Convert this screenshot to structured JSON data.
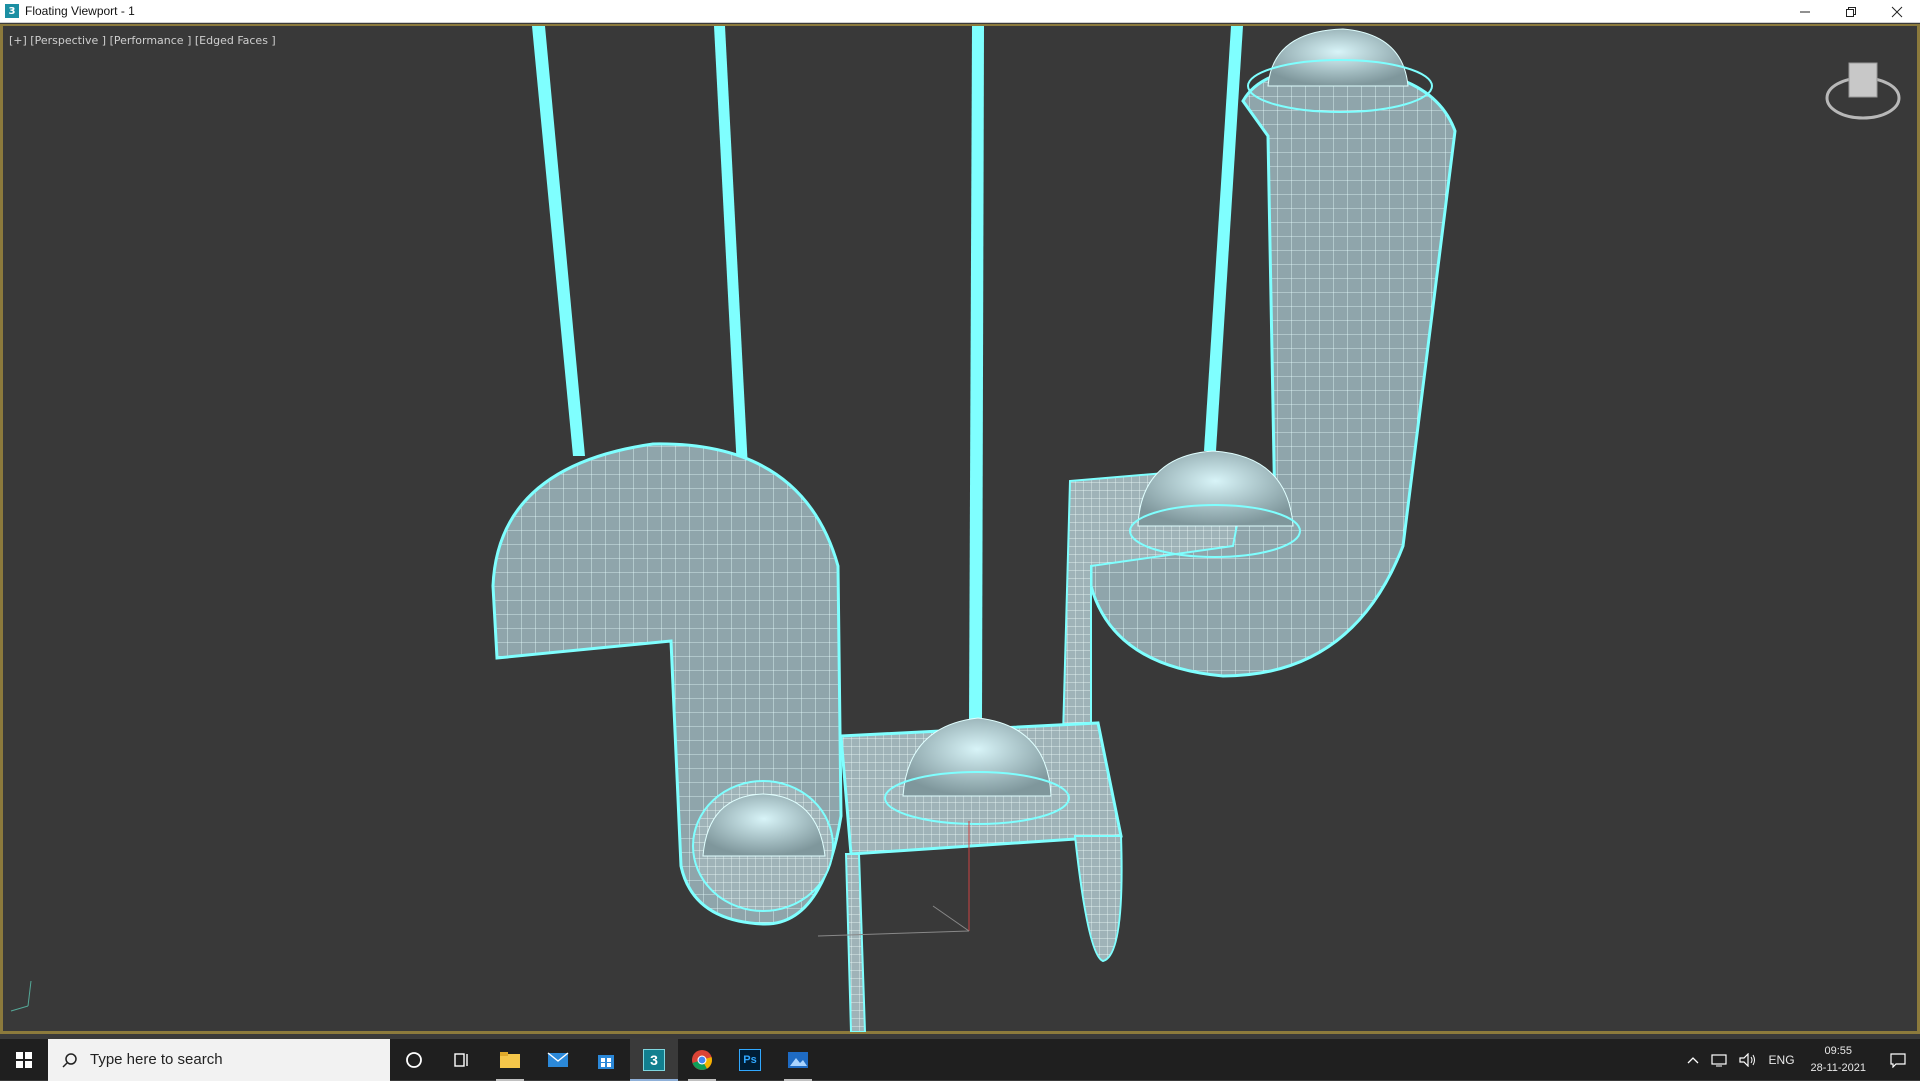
{
  "window": {
    "title": "Floating Viewport - 1",
    "app_icon_glyph": "3",
    "minimize_icon": "minimize-icon",
    "maximize_icon": "restore-icon",
    "close_icon": "close-icon"
  },
  "viewport": {
    "label": "[+] [Perspective ] [Performance ] [Edged Faces ]",
    "background_color": "#393939",
    "wire_color": "#7fffff",
    "border_color": "#8c7a3c"
  },
  "taskbar": {
    "search_placeholder": "Type here to search",
    "apps": [
      {
        "name": "cortana",
        "icon": "circle-icon"
      },
      {
        "name": "task-view",
        "icon": "task-view-icon"
      },
      {
        "name": "file-explorer",
        "icon": "folder-icon"
      },
      {
        "name": "mail",
        "icon": "mail-icon"
      },
      {
        "name": "store",
        "icon": "store-icon"
      },
      {
        "name": "3ds-max",
        "icon": "3dsmax-icon",
        "glyph": "3"
      },
      {
        "name": "chrome",
        "icon": "chrome-icon"
      },
      {
        "name": "photoshop",
        "icon": "photoshop-icon",
        "glyph": "Ps"
      },
      {
        "name": "photos",
        "icon": "photos-icon"
      }
    ],
    "tray": {
      "language": "ENG",
      "time": "09:55",
      "date": "28-11-2021"
    }
  }
}
